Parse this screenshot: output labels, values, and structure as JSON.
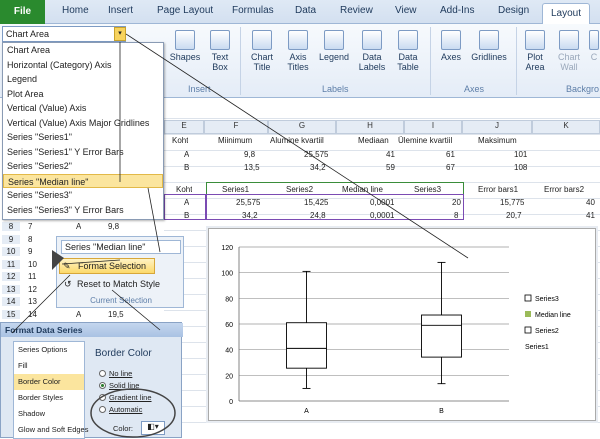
{
  "ribbon": {
    "tabs": [
      "File",
      "Home",
      "Insert",
      "Page Layout",
      "Formulas",
      "Data",
      "Review",
      "View",
      "Add-Ins",
      "Design",
      "Layout"
    ],
    "buttons": {
      "shapes": "Shapes",
      "text_box": "Text Box",
      "chart_title": "Chart Title",
      "axis_titles": "Axis Titles",
      "legend": "Legend",
      "data_labels": "Data Labels",
      "data_table": "Data Table",
      "axes": "Axes",
      "gridlines": "Gridlines",
      "plot_area": "Plot Area",
      "chart_wall": "Chart Wall",
      "chart_floor": "C"
    },
    "groups": {
      "insert": "Insert",
      "labels": "Labels",
      "axes": "Axes",
      "background": "Backgro"
    }
  },
  "chart_element": {
    "selected": "Chart Area",
    "options": [
      "Chart Area",
      "Horizontal (Category) Axis",
      "Legend",
      "Plot Area",
      "Vertical (Value) Axis",
      "Vertical (Value) Axis Major Gridlines",
      "Series \"Series1\"",
      "Series \"Series1\" Y Error Bars",
      "Series \"Series2\"",
      "Series \"Median line\"",
      "Series \"Series3\"",
      "Series \"Series3\" Y Error Bars"
    ]
  },
  "sheet": {
    "col_headers": [
      "E",
      "F",
      "G",
      "H",
      "I",
      "J",
      "K"
    ],
    "table1": {
      "headers": [
        "Koht",
        "Miinimum",
        "Alumine kvartiil",
        "Mediaan",
        "Ülemine kvartiil",
        "Maksimum"
      ],
      "rows": [
        [
          "A",
          "9,8",
          "25,575",
          "41",
          "61",
          "101"
        ],
        [
          "B",
          "13,5",
          "34,2",
          "59",
          "67",
          "108"
        ]
      ]
    },
    "table2": {
      "headers": [
        "Koht",
        "Series1",
        "Series2",
        "Median line",
        "Series3",
        "Error bars1",
        "Error bars2"
      ],
      "rows": [
        [
          "A",
          "25,575",
          "15,425",
          "0,0001",
          "20",
          "15,775",
          "40"
        ],
        [
          "B",
          "34,2",
          "24,8",
          "0,0001",
          "8",
          "20,7",
          "41"
        ]
      ]
    },
    "left_rows": [
      {
        "num": "8",
        "b": "7",
        "c": "A",
        "d": "9,8"
      },
      {
        "num": "9",
        "b": "8",
        "c": "",
        "d": ""
      },
      {
        "num": "10",
        "b": "9",
        "c": "",
        "d": ""
      },
      {
        "num": "11",
        "b": "10",
        "c": "",
        "d": ""
      },
      {
        "num": "12",
        "b": "11",
        "c": "",
        "d": ""
      },
      {
        "num": "13",
        "b": "12",
        "c": "",
        "d": ""
      },
      {
        "num": "14",
        "b": "13",
        "c": "",
        "d": ""
      },
      {
        "num": "15",
        "b": "14",
        "c": "A",
        "d": "19,5"
      }
    ]
  },
  "format_popup": {
    "series": "Series \"Median line\"",
    "format_selection": "Format Selection",
    "reset": "Reset to Match Style",
    "group": "Current Selection"
  },
  "format_dialog": {
    "title": "Format Data Series",
    "options": [
      "Series Options",
      "Fill",
      "Border Color",
      "Border Styles",
      "Shadow",
      "Glow and Soft Edges"
    ],
    "heading": "Border Color",
    "radios": [
      "No line",
      "Solid line",
      "Gradient line",
      "Automatic"
    ],
    "color_label": "Color:"
  },
  "chart_data": {
    "type": "box",
    "categories": [
      "A",
      "B"
    ],
    "ylim": [
      0,
      120
    ],
    "yticks": [
      "0",
      "20",
      "40",
      "60",
      "80",
      "100",
      "120"
    ],
    "min": [
      9.8,
      13.5
    ],
    "q1": [
      25.575,
      34.2
    ],
    "median": [
      41,
      59
    ],
    "q3": [
      61,
      67
    ],
    "max": [
      101,
      108
    ],
    "legend": [
      "Series3",
      "Median line",
      "Series2",
      "Series1"
    ],
    "grid": true,
    "legend_position": "right"
  },
  "colors": {
    "file_tab": "#2a8a2e",
    "selection": "#fbe59e",
    "median_legend": "#9bbb59"
  }
}
